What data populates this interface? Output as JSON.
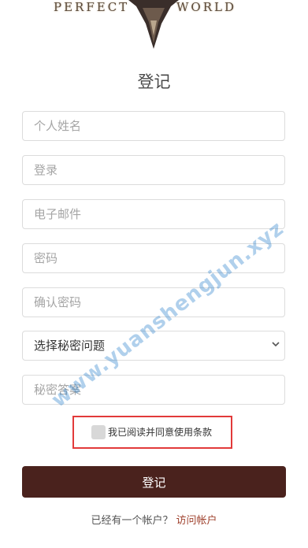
{
  "logo": {
    "word1": "PERFECT",
    "word2": "WORLD"
  },
  "title": "登记",
  "form": {
    "full_name_placeholder": "个人姓名",
    "login_placeholder": "登录",
    "email_placeholder": "电子邮件",
    "password_placeholder": "密码",
    "confirm_password_placeholder": "确认密码",
    "security_question_selected": "选择秘密问题",
    "security_answer_placeholder": "秘密答案",
    "terms_label": "我已阅读并同意使用条款",
    "submit_label": "登记"
  },
  "footer": {
    "prompt": "已经有一个帐户？",
    "link": "访问帐户"
  },
  "watermark": "www.yuanshengjun.xyz",
  "colors": {
    "submit_bg": "#4a221d",
    "link": "#a0432f",
    "highlight": "#e23a3a"
  }
}
